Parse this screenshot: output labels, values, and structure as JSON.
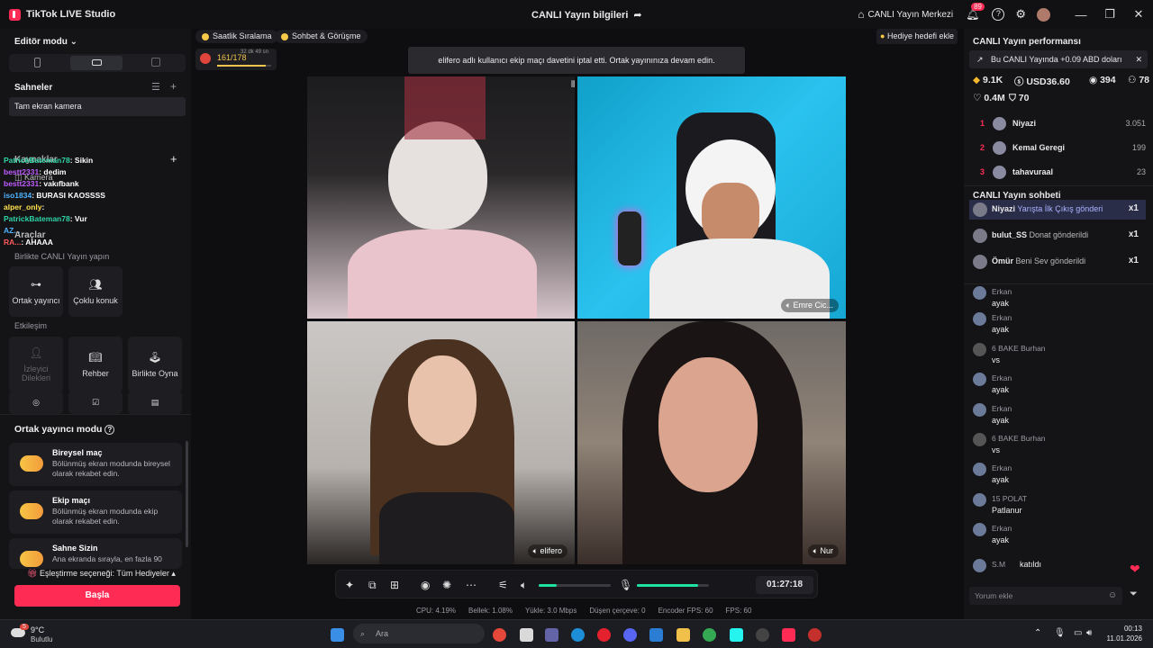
{
  "window": {
    "app_title": "TikTok LIVE Studio",
    "center_title": "CANLI Yayın bilgileri",
    "live_center": "CANLI Yayın Merkezi",
    "notif_count": "89"
  },
  "left": {
    "editor_mode": "Editör modu",
    "scenes_title": "Sahneler",
    "scene_item": "Tam ekran kamera",
    "sources_title": "Kaynaklar",
    "camera": "Kamera",
    "tools_title": "Araçlar",
    "co_live_title": "Birlikte CANLI Yayın yapın",
    "tiles1": [
      "Ortak yayıncı",
      "Çoklu konuk"
    ],
    "interaction_title": "Etkileşim",
    "tiles2": [
      "İzleyici Dilekleri",
      "Rehber",
      "Birlikte Oyna"
    ],
    "cohost_mode_title": "Ortak yayıncı modu",
    "modes": [
      {
        "title": "Bireysel maç",
        "desc": "Bölünmüş ekran modunda bireysel olarak rekabet edin."
      },
      {
        "title": "Ekip maçı",
        "desc": "Bölünmüş ekran modunda ekip olarak rekabet edin."
      },
      {
        "title": "Sahne Sizin",
        "desc": "Ana ekranda sırayla, en fazla 90"
      }
    ],
    "match_option": "Eşleştirme seçeneği: Tüm Hediyeler",
    "start_button": "Başla"
  },
  "chat_overlay": [
    {
      "user": "PatrickBateman78",
      "text": ": Sikin",
      "color": "#2fd4a6"
    },
    {
      "user": "bestt2331",
      "text": ": dedim",
      "color": "#c05cff"
    },
    {
      "user": "bestt2331",
      "text": ": vakıfbank",
      "color": "#c05cff"
    },
    {
      "user": "iso1834",
      "text": ": BURASI KAOSSSS",
      "color": "#4fb3ff"
    },
    {
      "user": "alper_only",
      "text": ":",
      "color": "#ffe14d"
    },
    {
      "user": "PatrickBateman78",
      "text": ": Vur",
      "color": "#2fd4a6"
    },
    {
      "user": "AZ...",
      "text": "",
      "color": "#4fb3ff"
    },
    {
      "user": "RA...",
      "text": ": AHAAA",
      "color": "#ff5a5a"
    }
  ],
  "top": {
    "pill1": "Saatlik Sıralama",
    "pill2": "Sohbet & Görüşme",
    "progress_text": "161/178",
    "timer_text": "32 dk 49 sn",
    "goal_button": "Hediye hedefi ekle",
    "toast": "elifero adlı kullanıcı ekip maçı davetini iptal etti. Ortak yayınınıza devam edin."
  },
  "video": {
    "names": [
      "",
      "Emre Cic...",
      "elifero",
      "Nur"
    ]
  },
  "controls": {
    "timer": "01:27:18",
    "mic_level": 0.85,
    "speaker_level": 0.25
  },
  "stats": [
    "CPU: 4.19%",
    "Bellek: 1.08%",
    "Yükle: 3.0 Mbps",
    "Düşen çerçeve: 0",
    "Encoder FPS: 60",
    "FPS: 60"
  ],
  "right": {
    "perf_title": "CANLI Yayın performansı",
    "banner": "Bu CANLI Yayında +0.09 ABD doları",
    "stats": {
      "coins": "9.1K",
      "usd": "USD36.60",
      "viewers": "394",
      "people": "78",
      "likes": "0.4M",
      "shares": "70"
    },
    "ranking": [
      {
        "n": "1",
        "user": "Niyazi",
        "v": "3.051"
      },
      {
        "n": "2",
        "user": "Kemal Geregi",
        "v": "199"
      },
      {
        "n": "3",
        "user": "tahavuraal",
        "v": "23"
      }
    ],
    "chat_title": "CANLI Yayın sohbeti",
    "gifts": [
      {
        "user": "Niyazi",
        "text": "Yarışta İlk Çıkış gönderi",
        "x": "x1"
      },
      {
        "user": "bulut_SS",
        "text": "Donat gönderildi",
        "x": "x1"
      },
      {
        "user": "Ömür",
        "text": "Beni Sev gönderildi",
        "x": "x1"
      }
    ],
    "messages": [
      {
        "user": "Erkan",
        "text": "ayak"
      },
      {
        "user": "Erkan",
        "text": "ayak"
      },
      {
        "user": "6  BAKE  Burhan",
        "text": "vs"
      },
      {
        "user": "Erkan",
        "text": "ayak"
      },
      {
        "user": "Erkan",
        "text": "ayak"
      },
      {
        "user": "6  BAKE  Burhan",
        "text": "vs"
      },
      {
        "user": "Erkan",
        "text": "ayak"
      },
      {
        "user": "15  POLAT",
        "text": "Patlanur"
      },
      {
        "user": "Erkan",
        "text": "ayak"
      },
      {
        "user": "S.M",
        "text": "katıldı"
      }
    ],
    "comment_placeholder": "Yorum ekle"
  },
  "taskbar": {
    "weather_temp": "9°C",
    "weather_desc": "Bulutlu",
    "search": "Ara",
    "time": "00:13",
    "date": "11.01.2026",
    "weather_badge": "5"
  }
}
